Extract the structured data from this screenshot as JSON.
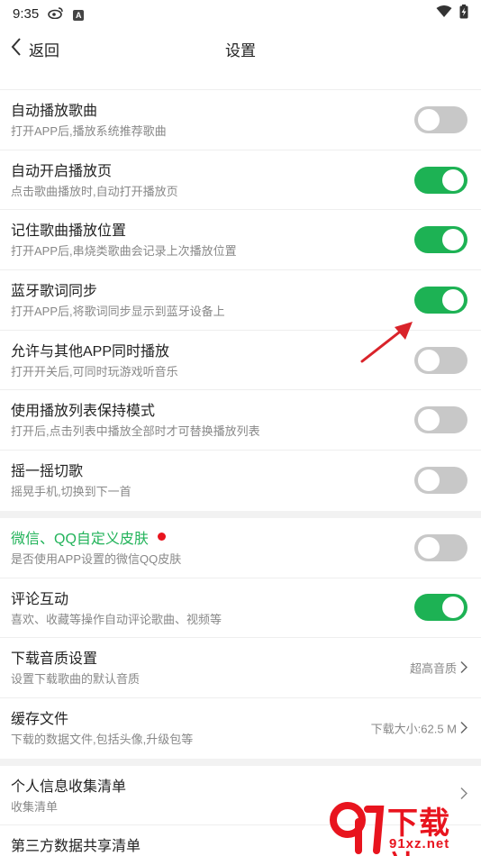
{
  "status_bar": {
    "time": "9:35",
    "icons": [
      "weibo-icon",
      "a-notification-icon",
      "wifi-icon",
      "battery-charging-icon"
    ]
  },
  "nav": {
    "back_label": "返回",
    "title": "设置"
  },
  "section1": [
    {
      "title": "自动播放歌曲",
      "subtitle": "打开APP后,播放系统推荐歌曲",
      "toggle": false
    },
    {
      "title": "自动开启播放页",
      "subtitle": "点击歌曲播放时,自动打开播放页",
      "toggle": true
    },
    {
      "title": "记住歌曲播放位置",
      "subtitle": "打开APP后,串烧类歌曲会记录上次播放位置",
      "toggle": true
    },
    {
      "title": "蓝牙歌词同步",
      "subtitle": "打开APP后,将歌词同步显示到蓝牙设备上",
      "toggle": true
    },
    {
      "title": "允许与其他APP同时播放",
      "subtitle": "打开开关后,可同时玩游戏听音乐",
      "toggle": false
    },
    {
      "title": "使用播放列表保持模式",
      "subtitle": "打开后,点击列表中播放全部时才可替换播放列表",
      "toggle": false
    },
    {
      "title": "摇一摇切歌",
      "subtitle": "摇晃手机,切换到下一首",
      "toggle": false
    }
  ],
  "section2": {
    "skin": {
      "title": "微信、QQ自定义皮肤",
      "subtitle": "是否使用APP设置的微信QQ皮肤",
      "toggle": false
    },
    "comment": {
      "title": "评论互动",
      "subtitle": "喜欢、收藏等操作自动评论歌曲、视频等",
      "toggle": true
    },
    "quality": {
      "title": "下载音质设置",
      "subtitle": "设置下载歌曲的默认音质",
      "value": "超高音质"
    },
    "cache": {
      "title": "缓存文件",
      "subtitle": "下载的数据文件,包括头像,升级包等",
      "value": "下载大小:62.5 M"
    }
  },
  "section3": {
    "privacy": {
      "title": "个人信息收集清单",
      "subtitle": "收集清单"
    },
    "thirdparty": {
      "title": "第三方数据共享清单"
    }
  },
  "colors": {
    "toggle_on": "#1db254",
    "toggle_off": "#c8c8c8",
    "accent_green": "#22b35a",
    "alert_red": "#e8141e"
  },
  "watermark": {
    "text": "下载站",
    "url": "91xz.net"
  }
}
